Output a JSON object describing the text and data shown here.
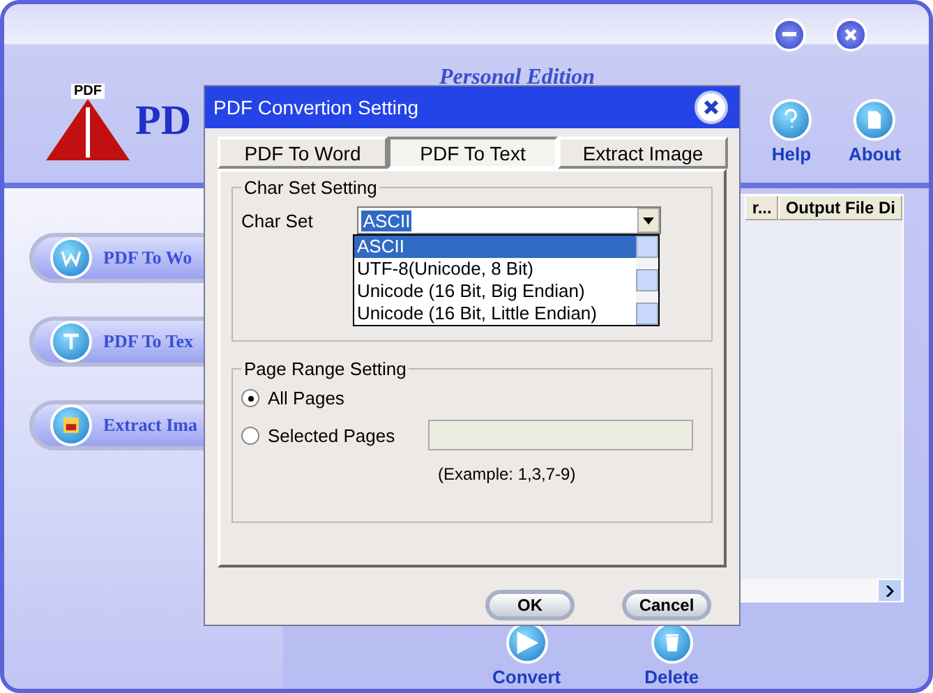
{
  "header": {
    "edition": "Personal Edition",
    "logo_badge": "PDF",
    "logo_text": "PD"
  },
  "toolbar": [
    {
      "kind": "help",
      "label": "Help"
    },
    {
      "kind": "about",
      "label": "About"
    }
  ],
  "sidebar": {
    "items": [
      {
        "kind": "word",
        "label": "PDF To Wo"
      },
      {
        "kind": "text",
        "label": "PDF To Tex"
      },
      {
        "kind": "image",
        "label": "Extract Ima"
      }
    ]
  },
  "table": {
    "columns": [
      "r...",
      "Output File Di"
    ]
  },
  "bottom_toolbar": [
    {
      "kind": "convert",
      "label": "Convert"
    },
    {
      "kind": "delete",
      "label": "Delete"
    }
  ],
  "dialog": {
    "title": "PDF Convertion Setting",
    "tabs": [
      {
        "label": "PDF To Word",
        "selected": false
      },
      {
        "label": "PDF To Text",
        "selected": true
      },
      {
        "label": "Extract Image",
        "selected": false
      }
    ],
    "char_set": {
      "title": "Char Set Setting",
      "label": "Char Set",
      "value": "ASCII",
      "expanded": true,
      "options": [
        {
          "label": "ASCII",
          "selected": true
        },
        {
          "label": "UTF-8(Unicode, 8 Bit)",
          "selected": false
        },
        {
          "label": "Unicode (16 Bit, Big Endian)",
          "selected": false
        },
        {
          "label": "Unicode (16 Bit, Little Endian)",
          "selected": false
        }
      ]
    },
    "page_range": {
      "title": "Page Range Setting",
      "options": [
        {
          "label": "All Pages",
          "selected": true
        },
        {
          "label": "Selected Pages",
          "selected": false
        }
      ],
      "example": "(Example: 1,3,7-9)"
    },
    "buttons": [
      "OK",
      "Cancel"
    ]
  }
}
